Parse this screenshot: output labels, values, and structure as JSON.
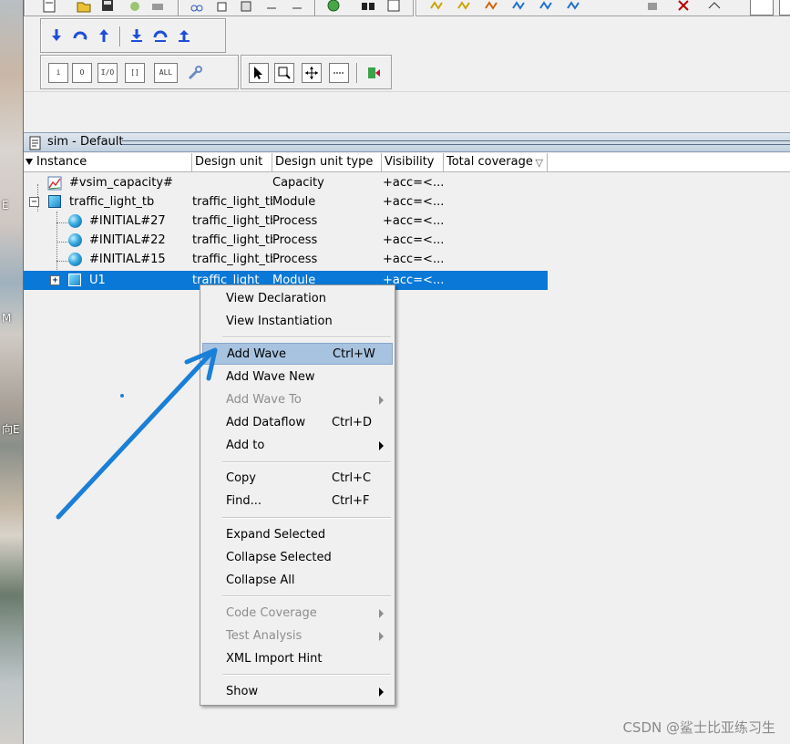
{
  "desktop": {
    "labels": [
      "E",
      "M",
      "向E"
    ]
  },
  "toolbar": {
    "row3_buttons": [
      "i",
      "O",
      "I/O",
      "[]",
      "ALL"
    ]
  },
  "pane": {
    "title": "sim - Default"
  },
  "columns": [
    "Instance",
    "Design unit",
    "Design unit type",
    "Visibility",
    "Total coverage"
  ],
  "rows": [
    {
      "instance": "#vsim_capacity#",
      "design_unit": "",
      "type": "Capacity",
      "visibility": "+acc=<..."
    },
    {
      "instance": "traffic_light_tb",
      "design_unit": "traffic_light_tb",
      "type": "Module",
      "visibility": "+acc=<..."
    },
    {
      "instance": "#INITIAL#27",
      "design_unit": "traffic_light_tb",
      "type": "Process",
      "visibility": "+acc=<..."
    },
    {
      "instance": "#INITIAL#22",
      "design_unit": "traffic_light_tb",
      "type": "Process",
      "visibility": "+acc=<..."
    },
    {
      "instance": "#INITIAL#15",
      "design_unit": "traffic_light_tb",
      "type": "Process",
      "visibility": "+acc=<..."
    },
    {
      "instance": "U1",
      "design_unit": "traffic_light",
      "type": "Module",
      "visibility": "+acc=<..."
    }
  ],
  "context_menu": {
    "items": [
      {
        "label": "View Declaration",
        "shortcut": "",
        "disabled": false,
        "submenu": false
      },
      {
        "label": "View Instantiation",
        "shortcut": "",
        "disabled": false,
        "submenu": false
      },
      {
        "label": "Add Wave",
        "shortcut": "Ctrl+W",
        "disabled": false,
        "submenu": false,
        "highlighted": true
      },
      {
        "label": "Add Wave New",
        "shortcut": "",
        "disabled": false,
        "submenu": false
      },
      {
        "label": "Add Wave To",
        "shortcut": "",
        "disabled": true,
        "submenu": true
      },
      {
        "label": "Add Dataflow",
        "shortcut": "Ctrl+D",
        "disabled": false,
        "submenu": false
      },
      {
        "label": "Add to",
        "shortcut": "",
        "disabled": false,
        "submenu": true
      },
      {
        "label": "Copy",
        "shortcut": "Ctrl+C",
        "disabled": false,
        "submenu": false
      },
      {
        "label": "Find...",
        "shortcut": "Ctrl+F",
        "disabled": false,
        "submenu": false
      },
      {
        "label": "Expand Selected",
        "shortcut": "",
        "disabled": false,
        "submenu": false
      },
      {
        "label": "Collapse Selected",
        "shortcut": "",
        "disabled": false,
        "submenu": false
      },
      {
        "label": "Collapse All",
        "shortcut": "",
        "disabled": false,
        "submenu": false
      },
      {
        "label": "Code Coverage",
        "shortcut": "",
        "disabled": true,
        "submenu": true
      },
      {
        "label": "Test Analysis",
        "shortcut": "",
        "disabled": true,
        "submenu": true
      },
      {
        "label": "XML Import Hint",
        "shortcut": "",
        "disabled": false,
        "submenu": false
      },
      {
        "label": "Show",
        "shortcut": "",
        "disabled": false,
        "submenu": true
      }
    ]
  },
  "watermark": "CSDN @鲨士比亚练习生",
  "colors": {
    "selection": "#0a78d7",
    "arrow": "#1a7fd6",
    "menu_highlight": "#a7c3e0"
  }
}
